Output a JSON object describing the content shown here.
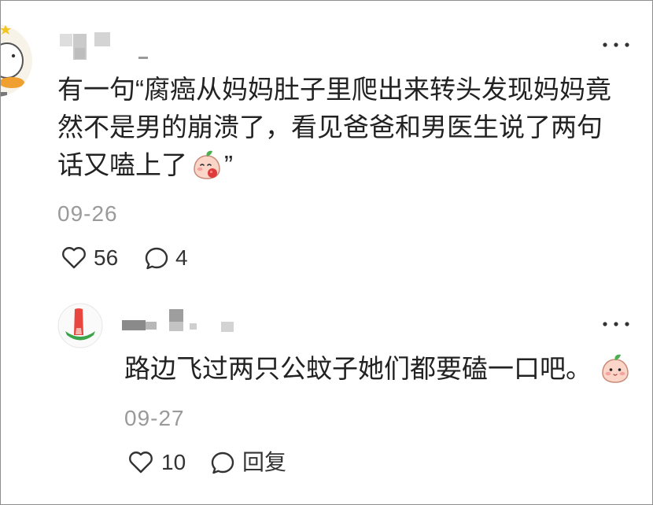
{
  "comment": {
    "avatar_icon": "cartoon-avatar",
    "more_icon": "more-options-icon",
    "text_lines": [
      "有一句“腐癌从妈妈肚子里爬出来转头发现妈妈竟",
      "然不是男的崩溃了，看见爸爸和男医生说了两句"
    ],
    "last_line": {
      "text": "话又嗑上了",
      "emoji": "peach-face-emoji",
      "after_emoji": "”"
    },
    "date": "09-26",
    "like_icon": "heart-icon",
    "like_count": "56",
    "reply_icon": "comment-bubble-icon",
    "reply_count": "4"
  },
  "reply": {
    "avatar_icon": "watermelon-avatar",
    "more_icon": "more-options-icon",
    "text": "路边飞过两只公蚊子她们都要磕一口吧。",
    "emoji": "peach-face-emoji",
    "date": "09-27",
    "like_icon": "heart-icon",
    "like_count": "10",
    "reply_icon": "comment-bubble-icon",
    "reply_label": "回复"
  },
  "colors": {
    "text": "#222222",
    "meta": "#9a9a9a",
    "icon": "#333333"
  }
}
